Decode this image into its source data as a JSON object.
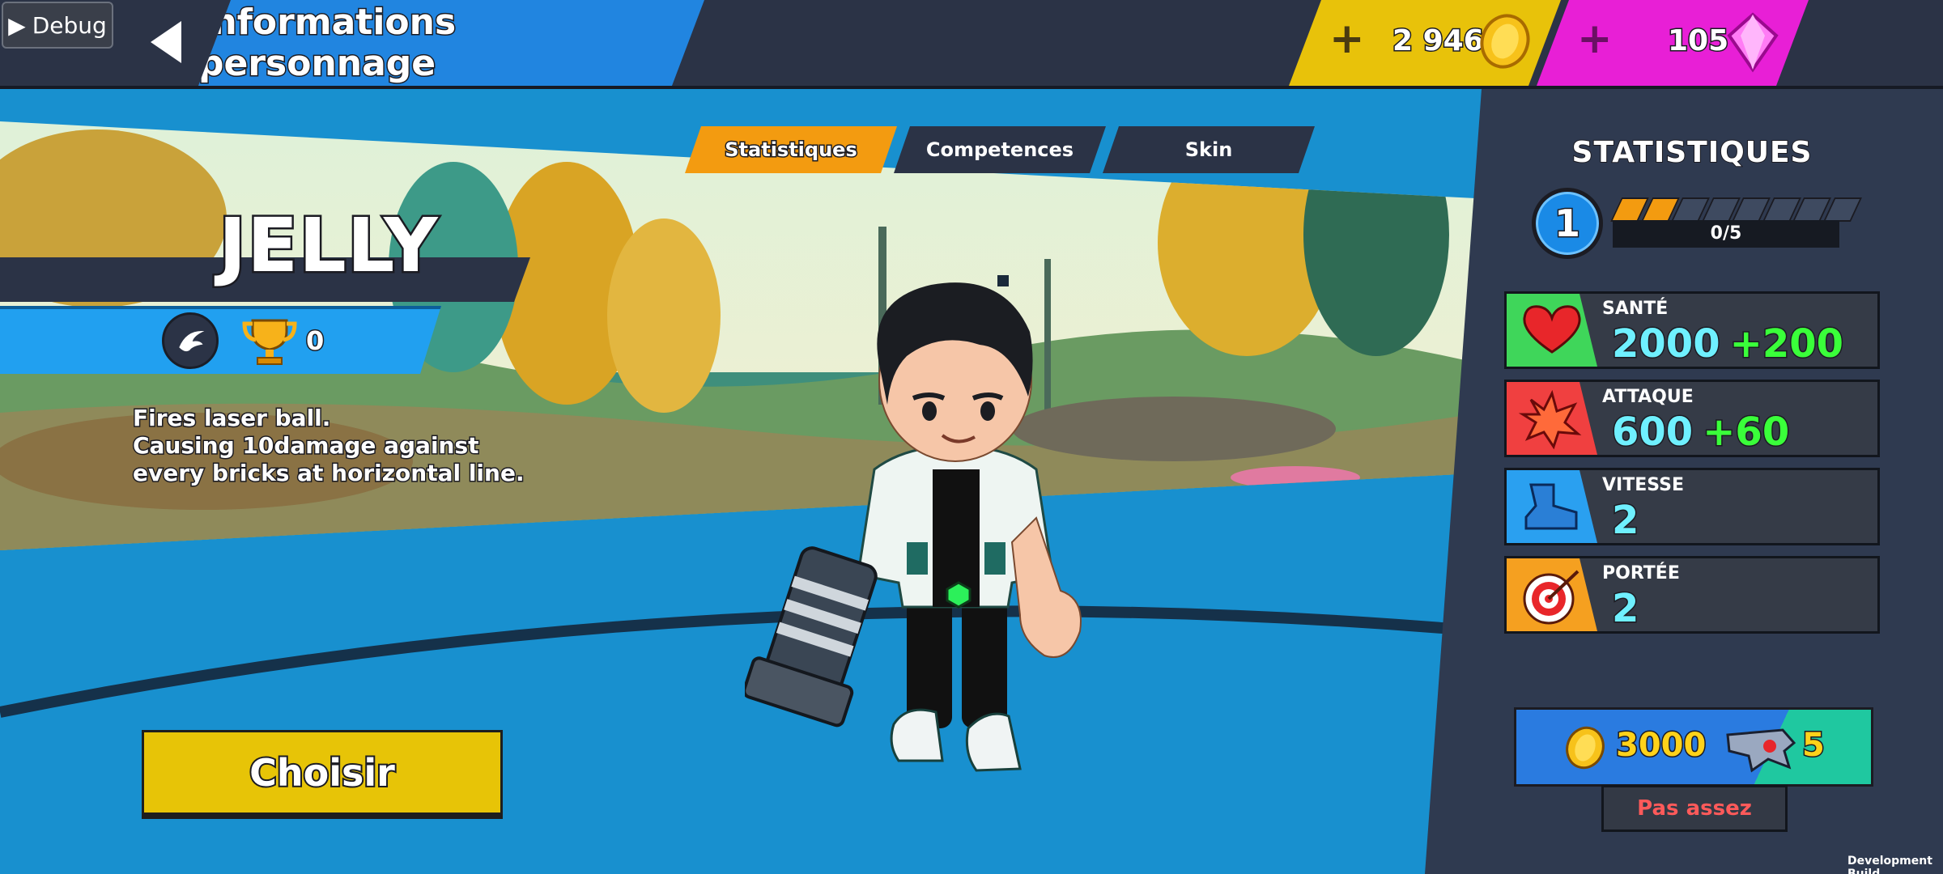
{
  "debug_label": "Debug",
  "header": {
    "title": "Informations personnage",
    "gold": "2 946",
    "gems": "105"
  },
  "tabs": [
    {
      "label": "Statistiques",
      "active": true
    },
    {
      "label": "Competences",
      "active": false
    },
    {
      "label": "Skin",
      "active": false
    }
  ],
  "character": {
    "name": "JELLY",
    "trophies": "0",
    "description": [
      "Fires laser ball.",
      "Causing 10damage against",
      "every bricks at horizontal line."
    ]
  },
  "choose_button": "Choisir",
  "stats_panel": {
    "title": "Statistiques",
    "level": "1",
    "progress": "0/5",
    "progress_fraction": 0.2,
    "stats": [
      {
        "label": "SANTÉ",
        "value": "2000",
        "bonus": "+200",
        "icon": "heart-icon",
        "color": "#3fd65a"
      },
      {
        "label": "ATTAQUE",
        "value": "600",
        "bonus": "+60",
        "icon": "explosion-icon",
        "color": "#f04040"
      },
      {
        "label": "VITESSE",
        "value": "2",
        "bonus": "",
        "icon": "boot-icon",
        "color": "#2aa0f0"
      },
      {
        "label": "PORTÉE",
        "value": "2",
        "bonus": "",
        "icon": "target-icon",
        "color": "#f5a020"
      }
    ]
  },
  "purchase": {
    "gold_cost": "3000",
    "item_cost": "5",
    "status": "Pas assez"
  },
  "build_label": "Development Build",
  "colors": {
    "accent_blue": "#2185e0",
    "gold": "#e8c20a",
    "gem": "#e81fd6",
    "tab_active": "#f39b10"
  }
}
